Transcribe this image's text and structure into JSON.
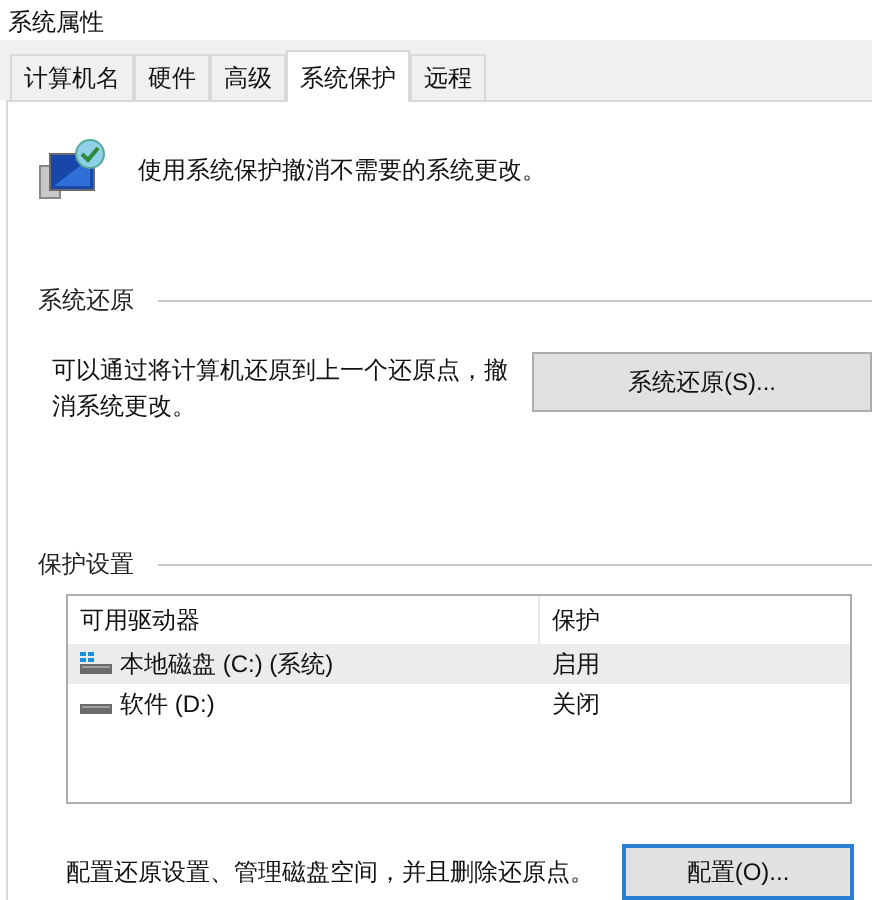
{
  "window": {
    "title": "系统属性"
  },
  "tabs": [
    {
      "label": "计算机名",
      "selected": false
    },
    {
      "label": "硬件",
      "selected": false
    },
    {
      "label": "高级",
      "selected": false
    },
    {
      "label": "系统保护",
      "selected": true
    },
    {
      "label": "远程",
      "selected": false
    }
  ],
  "intro": "使用系统保护撤消不需要的系统更改。",
  "restore_group": {
    "title": "系统还原",
    "description": "可以通过将计算机还原到上一个还原点，撤消系统更改。",
    "button": "系统还原(S)..."
  },
  "protection_group": {
    "title": "保护设置",
    "columns": [
      "可用驱动器",
      "保护"
    ],
    "rows": [
      {
        "drive": "本地磁盘 (C:) (系统)",
        "protection": "启用",
        "kind": "system",
        "selected": true
      },
      {
        "drive": "软件 (D:)",
        "protection": "关闭",
        "kind": "plain",
        "selected": false
      }
    ],
    "description": "配置还原设置、管理磁盘空间，并且删除还原点。",
    "button": "配置(O)..."
  }
}
